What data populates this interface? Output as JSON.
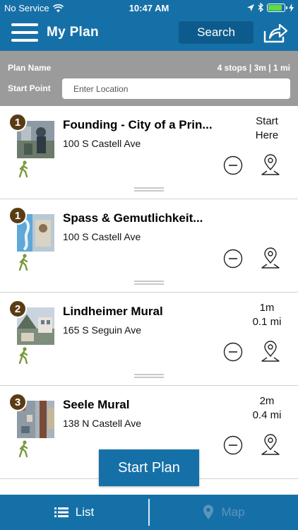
{
  "status_bar": {
    "carrier": "No Service",
    "time": "10:47 AM",
    "battery_level": 0.85,
    "battery_color": "#5fdc3f"
  },
  "nav": {
    "title": "My Plan",
    "search_label": "Search",
    "menu_icon": "hamburger-icon",
    "share_icon": "share-icon"
  },
  "plan": {
    "name_label": "Plan Name",
    "stats": "4 stops | 3m | 1 mi",
    "start_label": "Start Point",
    "start_placeholder": "Enter Location"
  },
  "stops": [
    {
      "number": "1",
      "title": "Founding - City of a Prin...",
      "address": "100 S Castell Ave",
      "meta_line1": "Start",
      "meta_line2": "Here"
    },
    {
      "number": "1",
      "title": "Spass & Gemutlichkeit...",
      "address": "100 S Castell Ave",
      "meta_line1": "",
      "meta_line2": ""
    },
    {
      "number": "2",
      "title": "Lindheimer Mural",
      "address": "165 S Seguin Ave",
      "meta_line1": "1m",
      "meta_line2": "0.1 mi"
    },
    {
      "number": "3",
      "title": "Seele Mural",
      "address": "138 N Castell Ave",
      "meta_line1": "2m",
      "meta_line2": "0.4 mi"
    }
  ],
  "actions": {
    "start_plan_label": "Start Plan"
  },
  "tabs": {
    "list_label": "List",
    "map_label": "Map"
  },
  "colors": {
    "primary": "#1670a8",
    "header_gray": "#9b9b9b",
    "badge": "#5a3c14",
    "walk_icon": "#7a9a3a"
  }
}
